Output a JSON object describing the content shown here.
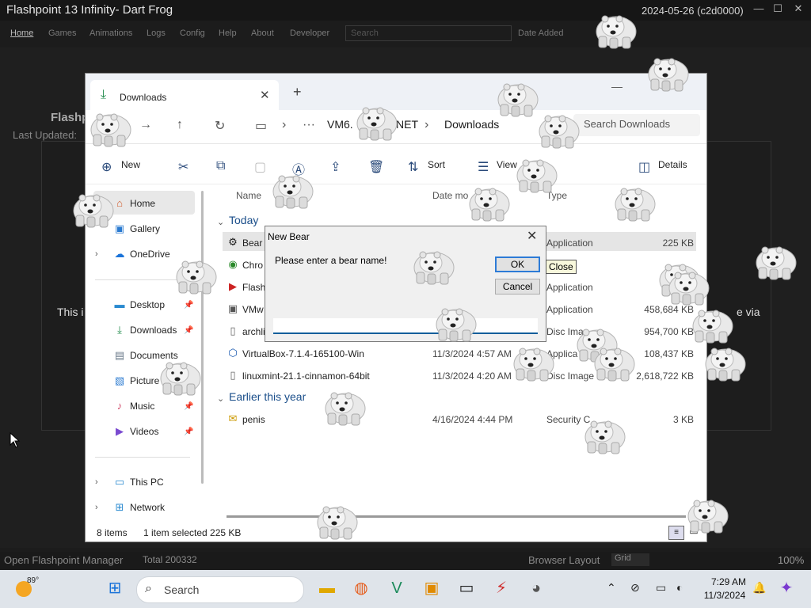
{
  "launcher": {
    "title": "Flashpoint 13 Infinity- Dart Frog",
    "build": "2024-05-26 (c2d0000)",
    "menu": [
      "Home",
      "Games",
      "Animations",
      "Logs",
      "Config",
      "Help",
      "About",
      "Developer"
    ],
    "search_placeholder": "Search",
    "sort_label": "Date Added",
    "side_title": "Flashp",
    "last_updated": "Last Updated:",
    "body_left": "This i",
    "body_right": "e via",
    "status": {
      "manager": "Open Flashpoint Manager",
      "total": "Total  200332",
      "layout_label": "Browser Layout",
      "layout_value": "Grid",
      "zoom": "100%"
    }
  },
  "explorer": {
    "tab_label": "Downloads",
    "breadcrumb": [
      "VM6.",
      "NET",
      "Downloads"
    ],
    "search_placeholder": "Search Downloads",
    "toolbar": {
      "new": "New",
      "sort": "Sort",
      "view": "View",
      "details": "Details"
    },
    "nav": {
      "home": "Home",
      "gallery": "Gallery",
      "onedrive": "OneDrive",
      "desktop": "Desktop",
      "downloads": "Downloads",
      "documents": "Documents",
      "pictures": "Picture",
      "music": "Music",
      "videos": "Videos",
      "thispc": "This PC",
      "network": "Network"
    },
    "columns": {
      "name": "Name",
      "date": "Date mo",
      "type": "Type"
    },
    "groups": {
      "today": "Today",
      "earlier": "Earlier this year"
    },
    "files": [
      {
        "name": "Bear",
        "date": "",
        "type": "Application",
        "size": "225 KB"
      },
      {
        "name": "Chro",
        "date": "",
        "type": "ation",
        "size": ""
      },
      {
        "name": "Flash",
        "date": "",
        "type": "Application",
        "size": ""
      },
      {
        "name": "VMw",
        "date": "",
        "type": "Application",
        "size": "458,684 KB"
      },
      {
        "name": "archli",
        "date": "",
        "type": "Disc Ima",
        "size": "954,700 KB"
      },
      {
        "name": "VirtualBox-7.1.4-165100-Win",
        "date": "11/3/2024 4:57 AM",
        "type": "Applica",
        "size": "108,437 KB"
      },
      {
        "name": "linuxmint-21.1-cinnamon-64bit",
        "date": "11/3/2024 4:20 AM",
        "type": "Disc Image",
        "size": "2,618,722 KB"
      },
      {
        "name": "penis",
        "date": "4/16/2024 4:44 PM",
        "type": "Security C",
        "size": "3 KB"
      }
    ],
    "status": {
      "count": "8 items",
      "selected": "1 item selected  225 KB"
    }
  },
  "dialog": {
    "title": "New Bear",
    "prompt": "Please enter a bear name!",
    "ok": "OK",
    "cancel": "Cancel",
    "tooltip": "Close",
    "input_value": ""
  },
  "taskbar": {
    "weather": "89°",
    "search": "Search",
    "time": "7:29 AM",
    "date": "11/3/2024"
  },
  "colors": {
    "accent": "#2d7bd6",
    "explorer_bg": "#ffffff",
    "launcher_bg": "#1c1c1c",
    "taskbar_bg": "#dfe4ea"
  }
}
